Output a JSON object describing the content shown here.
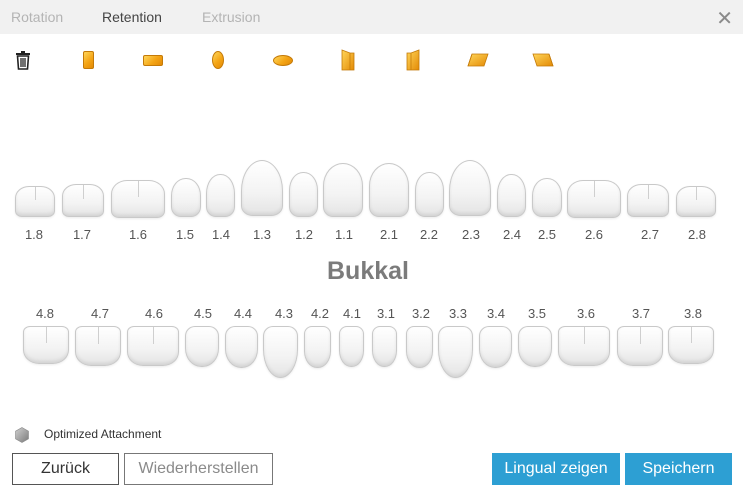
{
  "tabs": [
    {
      "label": "Rotation",
      "active": false
    },
    {
      "label": "Retention",
      "active": true
    },
    {
      "label": "Extrusion",
      "active": false
    }
  ],
  "close_icon": "close-icon",
  "toolbar": {
    "items": [
      "trash-icon",
      "attachment-vertical-rectangle-icon",
      "attachment-horizontal-rectangle-icon",
      "attachment-vertical-ellipse-icon",
      "attachment-horizontal-ellipse-icon",
      "attachment-bevel-left-icon",
      "attachment-bevel-right-icon",
      "attachment-bevel-top-icon",
      "attachment-bevel-bottom-icon"
    ]
  },
  "upper_teeth": [
    "1.8",
    "1.7",
    "1.6",
    "1.5",
    "1.4",
    "1.3",
    "1.2",
    "1.1",
    "2.1",
    "2.2",
    "2.3",
    "2.4",
    "2.5",
    "2.6",
    "2.7",
    "2.8"
  ],
  "lower_teeth": [
    "4.8",
    "4.7",
    "4.6",
    "4.5",
    "4.4",
    "4.3",
    "4.2",
    "4.1",
    "3.1",
    "3.2",
    "3.3",
    "3.4",
    "3.5",
    "3.6",
    "3.7",
    "3.8"
  ],
  "surface_label": "Bukkal",
  "legend": {
    "label": "Optimized Attachment",
    "icon": "optimized-attachment-hexagon-icon",
    "color": "#9a9a9a"
  },
  "buttons": {
    "back": "Zurück",
    "restore": "Wiederherstellen",
    "lingual": "Lingual zeigen",
    "save": "Speichern"
  },
  "colors": {
    "accent": "#2d9fd3",
    "attachment": "#f4a516"
  }
}
